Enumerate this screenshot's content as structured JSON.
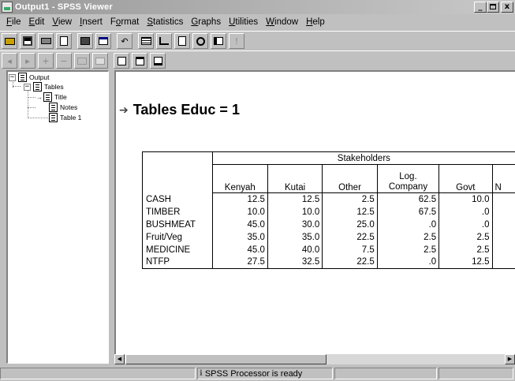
{
  "window": {
    "title": "Output1 - SPSS Viewer",
    "controls": {
      "minimize": "_",
      "maximize": " ",
      "close": "x"
    }
  },
  "menu": [
    {
      "label": "File",
      "underline": "F",
      "rest": "ile"
    },
    {
      "label": "Edit",
      "underline": "E",
      "rest": "dit"
    },
    {
      "label": "View",
      "underline": "V",
      "rest": "iew"
    },
    {
      "label": "Insert",
      "underline": "I",
      "rest": "nsert"
    },
    {
      "label": "Format",
      "pre": "F",
      "underline": "o",
      "rest": "rmat"
    },
    {
      "label": "Statistics",
      "underline": "S",
      "rest": "tatistics"
    },
    {
      "label": "Graphs",
      "underline": "G",
      "rest": "raphs"
    },
    {
      "label": "Utilities",
      "underline": "U",
      "rest": "tilities"
    },
    {
      "label": "Window",
      "underline": "W",
      "rest": "indow"
    },
    {
      "label": "Help",
      "underline": "H",
      "rest": "elp"
    }
  ],
  "toolbar1": [
    "open-icon",
    "save-icon",
    "print-icon",
    "print-preview-icon",
    "export-icon",
    "recall-dialog-icon",
    "undo-icon",
    "goto-data-icon",
    "goto-case-icon",
    "variables-icon",
    "find-icon",
    "select-last-output-icon",
    "designate-window-icon"
  ],
  "toolbar2": [
    "promote-icon",
    "demote-icon",
    "expand-icon",
    "collapse-icon",
    "show-icon",
    "hide-icon",
    "insert-heading-icon",
    "insert-title-icon",
    "insert-text-icon"
  ],
  "outline": {
    "root": "Output",
    "tables": "Tables",
    "title": "Title",
    "notes": "Notes",
    "table1": "Table 1"
  },
  "heading": "Tables Educ = 1",
  "pivot": {
    "spanner": "Stakeholders",
    "columns": [
      "Kenyah",
      "Kutai",
      "Other",
      "Log.\nCompany",
      "Govt",
      "N"
    ],
    "col_log_line1": "Log.",
    "col_log_line2": "Company",
    "rows": [
      {
        "label": "CASH",
        "values": [
          "12.5",
          "12.5",
          "2.5",
          "62.5",
          "10.0"
        ]
      },
      {
        "label": "TIMBER",
        "values": [
          "10.0",
          "10.0",
          "12.5",
          "67.5",
          ".0"
        ]
      },
      {
        "label": "BUSHMEAT",
        "values": [
          "45.0",
          "30.0",
          "25.0",
          ".0",
          ".0"
        ]
      },
      {
        "label": "Fruit/Veg",
        "values": [
          "35.0",
          "35.0",
          "22.5",
          "2.5",
          "2.5"
        ]
      },
      {
        "label": "MEDICINE",
        "values": [
          "45.0",
          "40.0",
          "7.5",
          "2.5",
          "2.5"
        ]
      },
      {
        "label": "NTFP",
        "values": [
          "27.5",
          "32.5",
          "22.5",
          ".0",
          "12.5"
        ]
      }
    ]
  },
  "status": {
    "processor": "SPSS Processor  is ready"
  }
}
